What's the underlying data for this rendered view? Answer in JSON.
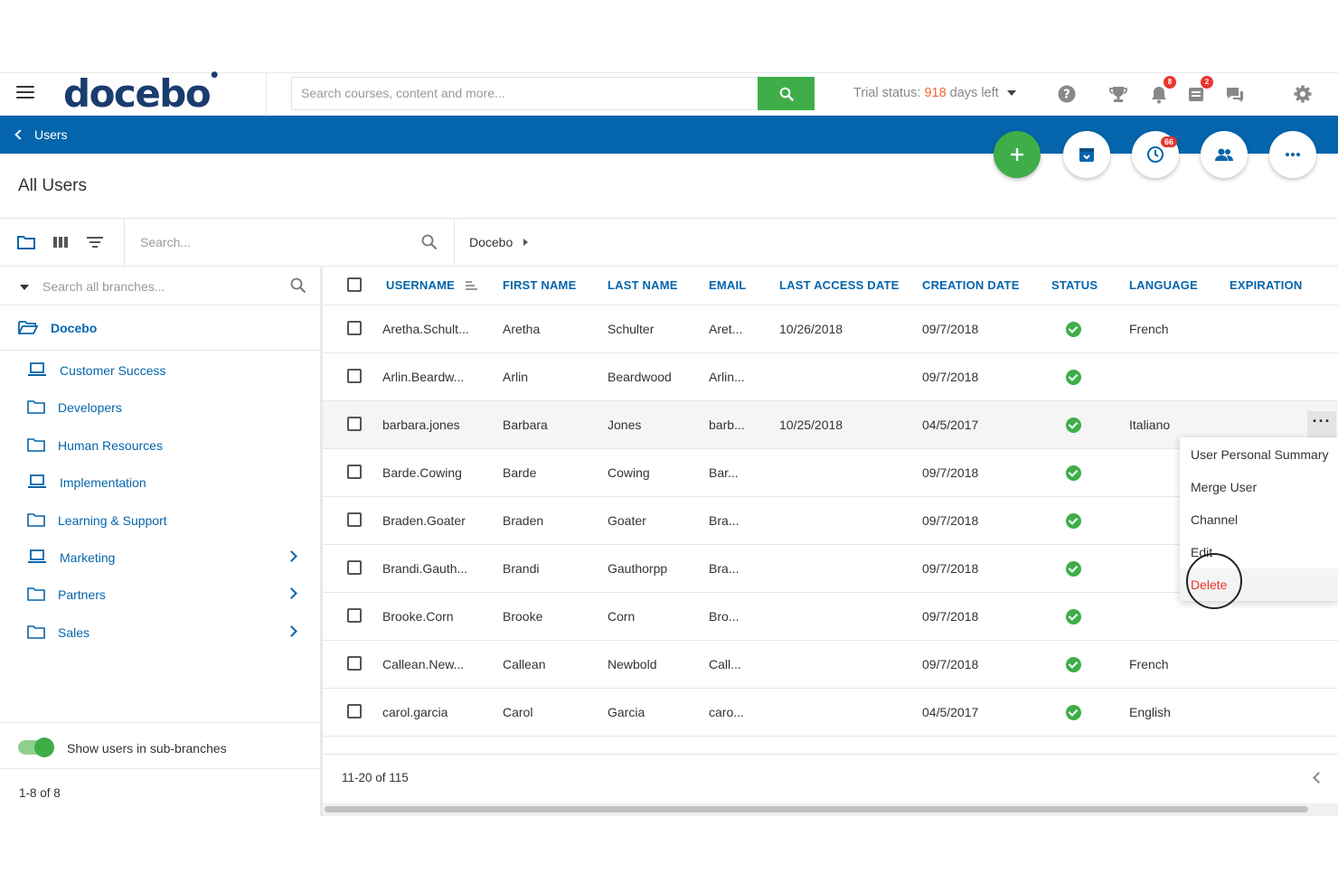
{
  "app": {
    "logo": "docebo",
    "search_placeholder": "Search courses, content and more...",
    "trial_prefix": "Trial status: ",
    "trial_days": "918",
    "trial_suffix": " days left",
    "badges": {
      "notifications": "8",
      "news": "2",
      "fab_history": "66"
    },
    "icons": [
      "menu-icon",
      "search-icon",
      "help-icon",
      "trophy-icon",
      "bell-icon",
      "news-icon",
      "chat-icon",
      "gear-icon"
    ],
    "colors": {
      "primary": "#0465ac",
      "success": "#3fae49",
      "danger": "#e8362e",
      "trial": "#f06a35"
    }
  },
  "nav": {
    "back_label": "Users"
  },
  "page": {
    "title": "All Users"
  },
  "toolbar": {
    "search_placeholder": "Search...",
    "breadcrumb": "Docebo"
  },
  "sidebar": {
    "search_placeholder": "Search all branches...",
    "root": "Docebo",
    "branches": [
      {
        "label": "Customer Success",
        "icon": "laptop-icon",
        "has_children": false
      },
      {
        "label": "Developers",
        "icon": "folder-icon",
        "has_children": false
      },
      {
        "label": "Human Resources",
        "icon": "folder-icon",
        "has_children": false
      },
      {
        "label": "Implementation",
        "icon": "laptop-icon",
        "has_children": false
      },
      {
        "label": "Learning & Support",
        "icon": "folder-icon",
        "has_children": false
      },
      {
        "label": "Marketing",
        "icon": "laptop-icon",
        "has_children": true
      },
      {
        "label": "Partners",
        "icon": "folder-icon",
        "has_children": true
      },
      {
        "label": "Sales",
        "icon": "folder-icon",
        "has_children": true
      }
    ],
    "subbranch_label": "Show users in sub-branches",
    "subbranch_on": true,
    "count": "1-8 of 8"
  },
  "table": {
    "headers": [
      "USERNAME",
      "FIRST NAME",
      "LAST NAME",
      "EMAIL",
      "LAST ACCESS DATE",
      "CREATION DATE",
      "STATUS",
      "LANGUAGE",
      "EXPIRATION"
    ],
    "rows": [
      {
        "username": "Aretha.Schult...",
        "first": "Aretha",
        "last": "Schulter",
        "email": "Aret...",
        "last_access": "10/26/2018",
        "created": "09/7/2018",
        "status": "active",
        "language": "French"
      },
      {
        "username": "Arlin.Beardw...",
        "first": "Arlin",
        "last": "Beardwood",
        "email": "Arlin...",
        "last_access": "",
        "created": "09/7/2018",
        "status": "active",
        "language": ""
      },
      {
        "username": "barbara.jones",
        "first": "Barbara",
        "last": "Jones",
        "email": "barb...",
        "last_access": "10/25/2018",
        "created": "04/5/2017",
        "status": "active",
        "language": "Italiano"
      },
      {
        "username": "Barde.Cowing",
        "first": "Barde",
        "last": "Cowing",
        "email": "Bar...",
        "last_access": "",
        "created": "09/7/2018",
        "status": "active",
        "language": ""
      },
      {
        "username": "Braden.Goater",
        "first": "Braden",
        "last": "Goater",
        "email": "Bra...",
        "last_access": "",
        "created": "09/7/2018",
        "status": "active",
        "language": ""
      },
      {
        "username": "Brandi.Gauth...",
        "first": "Brandi",
        "last": "Gauthorpp",
        "email": "Bra...",
        "last_access": "",
        "created": "09/7/2018",
        "status": "active",
        "language": ""
      },
      {
        "username": "Brooke.Corn",
        "first": "Brooke",
        "last": "Corn",
        "email": "Bro...",
        "last_access": "",
        "created": "09/7/2018",
        "status": "active",
        "language": ""
      },
      {
        "username": "Callean.New...",
        "first": "Callean",
        "last": "Newbold",
        "email": "Call...",
        "last_access": "",
        "created": "09/7/2018",
        "status": "active",
        "language": "French"
      },
      {
        "username": "carol.garcia",
        "first": "Carol",
        "last": "Garcia",
        "email": "caro...",
        "last_access": "",
        "created": "04/5/2017",
        "status": "active",
        "language": "English"
      }
    ],
    "pagination": "11-20 of 115"
  },
  "context_menu": {
    "items": [
      "User Personal Summary",
      "Merge User",
      "Channel",
      "Edit",
      "Delete"
    ]
  }
}
